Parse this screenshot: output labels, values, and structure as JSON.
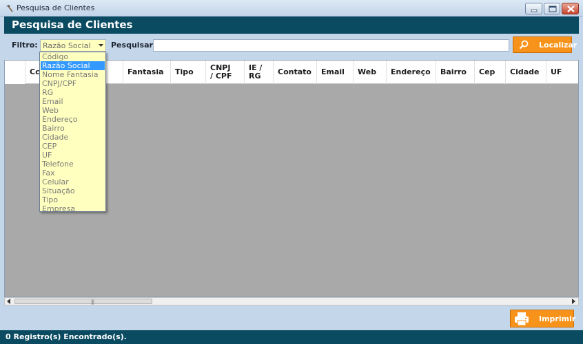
{
  "window": {
    "title": "Pesquisa de Clientes"
  },
  "header": {
    "title": "Pesquisa de Clientes"
  },
  "toolbar": {
    "filter_label": "Filtro:",
    "filter_value": "Razão Social",
    "search_label": "Pesquisar:",
    "search_value": "",
    "locate_label": "Localizar"
  },
  "grid": {
    "columns": [
      "Código",
      "Fantasia",
      "Tipo",
      "CNPJ / CPF",
      "IE / RG",
      "Contato",
      "Email",
      "Web",
      "Endereço",
      "Bairro",
      "Cep",
      "Cidade",
      "UF"
    ],
    "column_labels": [
      "Cc",
      "Fantasia",
      "Tipo",
      "CNPJ\n/ CPF",
      "IE /\nRG",
      "Contato",
      "Email",
      "Web",
      "Endereço",
      "Bairro",
      "Cep",
      "Cidade",
      "UF"
    ],
    "rows": []
  },
  "dropdown": {
    "options": [
      "Código",
      "Razão Social",
      "Nome Fantasia",
      "CNPJ/CPF",
      "RG",
      "Email",
      "Web",
      "Endereço",
      "Bairro",
      "Cidade",
      "CEP",
      "UF",
      "Telefone",
      "Fax",
      "Celular",
      "Situação",
      "Tipo",
      "Empresa"
    ],
    "selected_index": 1
  },
  "print_button": {
    "label": "Imprimir"
  },
  "status": {
    "text": "0 Registro(s) Encontrado(s)."
  },
  "colors": {
    "header_bg": "#0b4b62",
    "window_bg": "#c4d6ea",
    "accent_orange": "#f7931a",
    "combo_bg": "#ffffbf",
    "selection": "#3399ff",
    "grid_bg": "#a9a9a9"
  },
  "icons": {
    "app": "hammer-icon",
    "locate": "search-icon",
    "print": "printer-icon"
  }
}
